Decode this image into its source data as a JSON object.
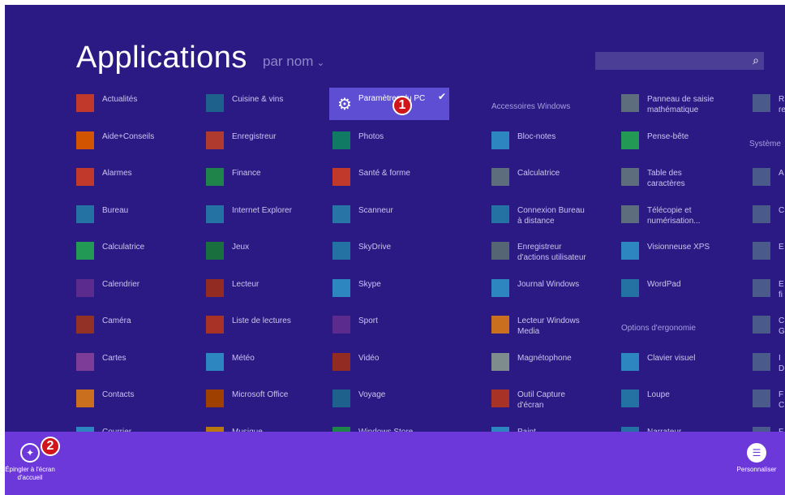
{
  "header": {
    "title": "Applications",
    "sort_label": "par nom",
    "search_placeholder": ""
  },
  "selected_app": {
    "label": "Paramètres du PC",
    "badge": "1"
  },
  "columns": [
    {
      "header": "",
      "items": [
        {
          "label": "Actualités",
          "icon": "news-icon",
          "color": "#c0392b"
        },
        {
          "label": "Aide+Conseils",
          "icon": "help-icon",
          "color": "#d35400"
        },
        {
          "label": "Alarmes",
          "icon": "alarm-icon",
          "color": "#c0392b"
        },
        {
          "label": "Bureau",
          "icon": "desktop-icon",
          "color": "#2471a3"
        },
        {
          "label": "Calculatrice",
          "icon": "calculator-icon",
          "color": "#229954"
        },
        {
          "label": "Calendrier",
          "icon": "calendar-icon",
          "color": "#5b2c8d"
        },
        {
          "label": "Caméra",
          "icon": "camera-icon",
          "color": "#943126"
        },
        {
          "label": "Cartes",
          "icon": "maps-icon",
          "color": "#7d3c98"
        },
        {
          "label": "Contacts",
          "icon": "people-icon",
          "color": "#ca6f1e"
        },
        {
          "label": "Courrier",
          "icon": "mail-icon",
          "color": "#2e86c1"
        }
      ]
    },
    {
      "header": "",
      "items": [
        {
          "label": "Cuisine & vins",
          "icon": "food-icon",
          "color": "#1f618d"
        },
        {
          "label": "Enregistreur",
          "icon": "microphone-icon",
          "color": "#b03a2e"
        },
        {
          "label": "Finance",
          "icon": "finance-icon",
          "color": "#1e8449"
        },
        {
          "label": "Internet Explorer",
          "icon": "ie-icon",
          "color": "#2471a3"
        },
        {
          "label": "Jeux",
          "icon": "games-icon",
          "color": "#196f3d"
        },
        {
          "label": "Lecteur",
          "icon": "reader-icon",
          "color": "#922b21"
        },
        {
          "label": "Liste de lectures",
          "icon": "reading-list-icon",
          "color": "#a93226"
        },
        {
          "label": "Météo",
          "icon": "weather-icon",
          "color": "#2e86c1"
        },
        {
          "label": "Microsoft Office",
          "icon": "office-icon",
          "color": "#a04000"
        },
        {
          "label": "Musique",
          "icon": "music-icon",
          "color": "#b9770e"
        }
      ]
    },
    {
      "header": "",
      "items": [
        {
          "label": "",
          "icon": "",
          "color": ""
        },
        {
          "label": "Photos",
          "icon": "photos-icon",
          "color": "#117a65"
        },
        {
          "label": "Santé & forme",
          "icon": "health-icon",
          "color": "#c0392b"
        },
        {
          "label": "Scanneur",
          "icon": "scanner-icon",
          "color": "#2874a6"
        },
        {
          "label": "SkyDrive",
          "icon": "skydrive-icon",
          "color": "#2471a3"
        },
        {
          "label": "Skype",
          "icon": "skype-icon",
          "color": "#2e86c1"
        },
        {
          "label": "Sport",
          "icon": "sport-icon",
          "color": "#5b2c8d"
        },
        {
          "label": "Vidéo",
          "icon": "video-icon",
          "color": "#922b21"
        },
        {
          "label": "Voyage",
          "icon": "travel-icon",
          "color": "#1f618d"
        },
        {
          "label": "Windows Store",
          "icon": "store-icon",
          "color": "#1e8449"
        }
      ]
    },
    {
      "header": "Accessoires Windows",
      "items": [
        {
          "label": "",
          "icon": "",
          "color": ""
        },
        {
          "label": "Bloc-notes",
          "icon": "notepad-icon",
          "color": "#2e86c1"
        },
        {
          "label": "Calculatrice",
          "icon": "calculator-icon",
          "color": "#5d6d7e"
        },
        {
          "label": "Connexion Bureau\nà distance",
          "icon": "remote-desktop-icon",
          "color": "#2471a3"
        },
        {
          "label": "Enregistreur\nd'actions utilisateur",
          "icon": "steps-recorder-icon",
          "color": "#566573"
        },
        {
          "label": "Journal Windows",
          "icon": "journal-icon",
          "color": "#2e86c1"
        },
        {
          "label": "Lecteur Windows\nMedia",
          "icon": "media-player-icon",
          "color": "#ca6f1e"
        },
        {
          "label": "Magnétophone",
          "icon": "sound-recorder-icon",
          "color": "#7f8c8d"
        },
        {
          "label": "Outil Capture\nd'écran",
          "icon": "snipping-tool-icon",
          "color": "#a93226"
        },
        {
          "label": "Paint",
          "icon": "paint-icon",
          "color": "#2e86c1"
        }
      ]
    },
    {
      "header": "",
      "items": [
        {
          "label": "Panneau de saisie\nmathématique",
          "icon": "math-input-icon",
          "color": "#5d6d7e"
        },
        {
          "label": "Pense-bête",
          "icon": "sticky-notes-icon",
          "color": "#229954"
        },
        {
          "label": "Table des\ncaractères",
          "icon": "character-map-icon",
          "color": "#5d6d7e"
        },
        {
          "label": "Télécopie et\nnumérisation...",
          "icon": "fax-icon",
          "color": "#5d6d7e"
        },
        {
          "label": "Visionneuse XPS",
          "icon": "xps-viewer-icon",
          "color": "#2e86c1"
        },
        {
          "label": "WordPad",
          "icon": "wordpad-icon",
          "color": "#2471a3"
        },
        {
          "label": "",
          "icon": "",
          "color": ""
        },
        {
          "label": "Clavier visuel",
          "icon": "keyboard-icon",
          "color": "#2e86c1"
        },
        {
          "label": "Loupe",
          "icon": "magnifier-icon",
          "color": "#2471a3"
        },
        {
          "label": "Narrateur",
          "icon": "narrator-icon",
          "color": "#2471a3"
        }
      ]
    }
  ],
  "ergonomie_header": "Options d'ergonomie",
  "partial_column": {
    "header": "Système",
    "items": [
      {
        "label": "R\nre",
        "icon": "partial-icon"
      },
      {
        "label": "",
        "icon": ""
      },
      {
        "label": "A",
        "icon": "help-icon"
      },
      {
        "label": "C",
        "icon": "partial-icon"
      },
      {
        "label": "E",
        "icon": "partial-icon"
      },
      {
        "label": "E\nfi",
        "icon": "partial-icon"
      },
      {
        "label": "C\nG",
        "icon": "partial-icon"
      },
      {
        "label": "I\nD",
        "icon": "partial-icon"
      },
      {
        "label": "F\nC",
        "icon": "partial-icon"
      },
      {
        "label": "F",
        "icon": "partial-icon"
      }
    ]
  },
  "appbar": {
    "pin_label": "Épingler à l'écran\nd'accueil",
    "pin_badge": "2",
    "customize_label": "Personnaliser"
  },
  "glyphs": {
    "search": "⌕",
    "gear": "⚙",
    "check": "✔",
    "chevron": "⌄",
    "pin": "✦",
    "menu": "☰"
  }
}
